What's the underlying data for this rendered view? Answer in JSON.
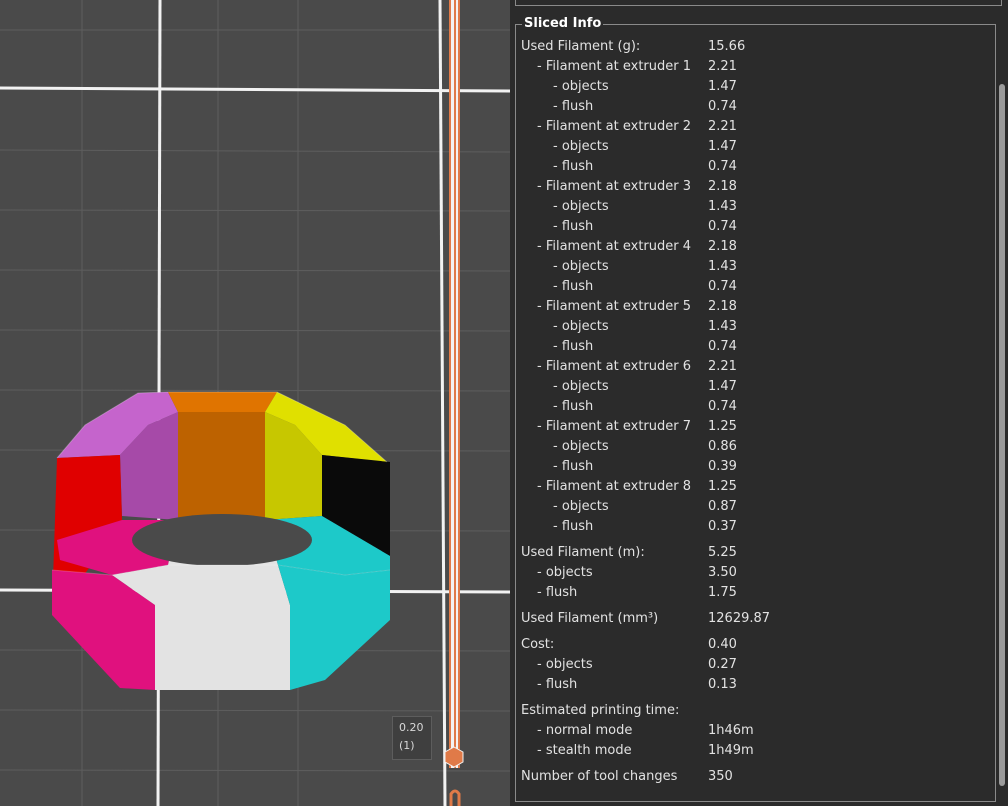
{
  "slider": {
    "layer_height": "0.20",
    "layer_index": "(1)"
  },
  "sliced_info": {
    "title": "Sliced Info",
    "rows": [
      {
        "label": "Used Filament (g):",
        "value": "15.66",
        "indent": 0,
        "gap": false
      },
      {
        "label": "- Filament at extruder 1",
        "value": "2.21",
        "indent": 1,
        "gap": false
      },
      {
        "label": "- objects",
        "value": "1.47",
        "indent": 2,
        "gap": false
      },
      {
        "label": "- flush",
        "value": "0.74",
        "indent": 2,
        "gap": false
      },
      {
        "label": "- Filament at extruder 2",
        "value": "2.21",
        "indent": 1,
        "gap": false
      },
      {
        "label": "- objects",
        "value": "1.47",
        "indent": 2,
        "gap": false
      },
      {
        "label": "- flush",
        "value": "0.74",
        "indent": 2,
        "gap": false
      },
      {
        "label": "- Filament at extruder 3",
        "value": "2.18",
        "indent": 1,
        "gap": false
      },
      {
        "label": "- objects",
        "value": "1.43",
        "indent": 2,
        "gap": false
      },
      {
        "label": "- flush",
        "value": "0.74",
        "indent": 2,
        "gap": false
      },
      {
        "label": "- Filament at extruder 4",
        "value": "2.18",
        "indent": 1,
        "gap": false
      },
      {
        "label": "- objects",
        "value": "1.43",
        "indent": 2,
        "gap": false
      },
      {
        "label": "- flush",
        "value": "0.74",
        "indent": 2,
        "gap": false
      },
      {
        "label": "- Filament at extruder 5",
        "value": "2.18",
        "indent": 1,
        "gap": false
      },
      {
        "label": "- objects",
        "value": "1.43",
        "indent": 2,
        "gap": false
      },
      {
        "label": "- flush",
        "value": "0.74",
        "indent": 2,
        "gap": false
      },
      {
        "label": "- Filament at extruder 6",
        "value": "2.21",
        "indent": 1,
        "gap": false
      },
      {
        "label": "- objects",
        "value": "1.47",
        "indent": 2,
        "gap": false
      },
      {
        "label": "- flush",
        "value": "0.74",
        "indent": 2,
        "gap": false
      },
      {
        "label": "- Filament at extruder 7",
        "value": "1.25",
        "indent": 1,
        "gap": false
      },
      {
        "label": "- objects",
        "value": "0.86",
        "indent": 2,
        "gap": false
      },
      {
        "label": "- flush",
        "value": "0.39",
        "indent": 2,
        "gap": false
      },
      {
        "label": "- Filament at extruder 8",
        "value": "1.25",
        "indent": 1,
        "gap": false
      },
      {
        "label": "- objects",
        "value": "0.87",
        "indent": 2,
        "gap": false
      },
      {
        "label": "- flush",
        "value": "0.37",
        "indent": 2,
        "gap": false
      },
      {
        "label": "Used Filament (m):",
        "value": "5.25",
        "indent": 0,
        "gap": true
      },
      {
        "label": "- objects",
        "value": "3.50",
        "indent": 1,
        "gap": false
      },
      {
        "label": "- flush",
        "value": "1.75",
        "indent": 1,
        "gap": false
      },
      {
        "label": "Used Filament (mm³)",
        "value": "12629.87",
        "indent": 0,
        "gap": true
      },
      {
        "label": "Cost:",
        "value": "0.40",
        "indent": 0,
        "gap": true
      },
      {
        "label": "- objects",
        "value": "0.27",
        "indent": 1,
        "gap": false
      },
      {
        "label": "- flush",
        "value": "0.13",
        "indent": 1,
        "gap": false
      },
      {
        "label": "Estimated printing time:",
        "value": "",
        "indent": 0,
        "gap": true
      },
      {
        "label": "- normal mode",
        "value": "1h46m",
        "indent": 1,
        "gap": false
      },
      {
        "label": "- stealth mode",
        "value": "1h49m",
        "indent": 1,
        "gap": false
      },
      {
        "label": "Number of tool changes",
        "value": "350",
        "indent": 0,
        "gap": true
      }
    ]
  },
  "model_colors": {
    "red": "#e00000",
    "violet": "#c564cc",
    "orange": "#e07400",
    "yellow": "#e0e000",
    "black": "#0a0a0a",
    "magenta": "#e0117e",
    "white": "#e3e3e3",
    "cyan": "#1dc9c9"
  }
}
